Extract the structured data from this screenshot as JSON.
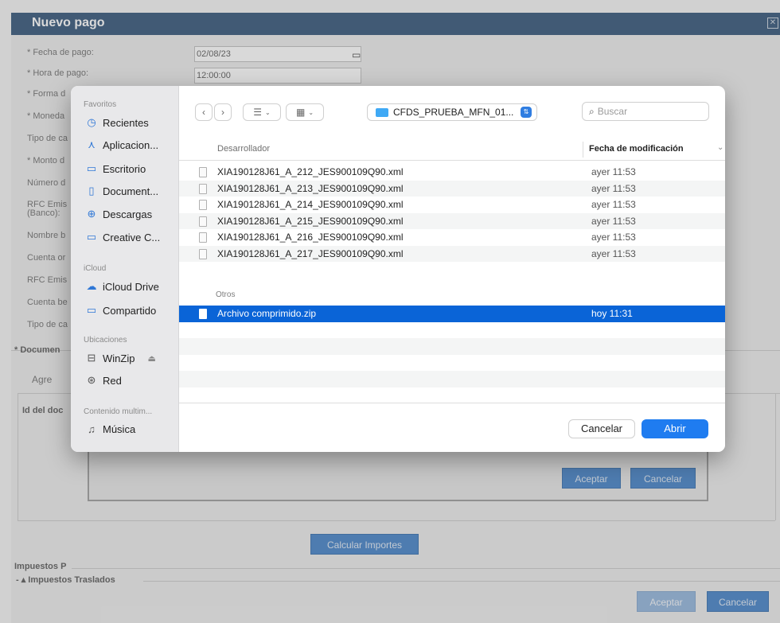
{
  "background_form": {
    "title": "Nuevo pago",
    "close_label": "✕",
    "labels": [
      "* Fecha de pago:",
      "* Hora de pago:",
      "* Forma d",
      "* Moneda",
      "Tipo de ca",
      "* Monto d",
      "Número d",
      "RFC Emis",
      "(Banco):",
      "Nombre b",
      "Cuenta or",
      "RFC Emis",
      "Cuenta be",
      "Tipo de ca"
    ],
    "fecha_value": "02/08/23",
    "hora_value": "12:00:00",
    "documentos_label": "* Documen",
    "agregar_label": "Agre",
    "id_documento_label": "Id del doc",
    "aceptar_label": "Aceptar",
    "cancelar_label": "Cancelar",
    "calcular_label": "Calcular Importes",
    "impuestos_label": "Impuestos P",
    "traslados_label": "Impuestos Traslados",
    "bottom_aceptar_label": "Aceptar",
    "bottom_cancelar_label": "Cancelar"
  },
  "sidebar": {
    "sections": [
      {
        "title": "Favoritos",
        "items": [
          {
            "label": "Recientes",
            "icon": "clock-icon"
          },
          {
            "label": "Aplicacion...",
            "icon": "apps-icon"
          },
          {
            "label": "Escritorio",
            "icon": "desktop-icon"
          },
          {
            "label": "Document...",
            "icon": "document-icon"
          },
          {
            "label": "Descargas",
            "icon": "download-icon"
          },
          {
            "label": "Creative C...",
            "icon": "folder-icon"
          }
        ]
      },
      {
        "title": "iCloud",
        "items": [
          {
            "label": "iCloud Drive",
            "icon": "cloud-icon"
          },
          {
            "label": "Compartido",
            "icon": "shared-folder-icon"
          }
        ]
      },
      {
        "title": "Ubicaciones",
        "items": [
          {
            "label": "WinZip",
            "icon": "drive-icon"
          },
          {
            "label": "Red",
            "icon": "network-icon"
          }
        ]
      },
      {
        "title": "Contenido multim...",
        "items": [
          {
            "label": "Música",
            "icon": "music-icon"
          }
        ]
      }
    ]
  },
  "toolbar": {
    "back_glyph": "‹",
    "forward_glyph": "›",
    "list_view_glyph": "☰",
    "grid_view_glyph": "▦",
    "location": "CFDS_PRUEBA_MFN_01...",
    "search_placeholder": "Buscar"
  },
  "columns": {
    "name": "Desarrollador",
    "date": "Fecha de modificación"
  },
  "files": [
    {
      "name": "XIA190128J61_A_212_JES900109Q90.xml",
      "date": "ayer 11:53"
    },
    {
      "name": "XIA190128J61_A_213_JES900109Q90.xml",
      "date": "ayer 11:53"
    },
    {
      "name": "XIA190128J61_A_214_JES900109Q90.xml",
      "date": "ayer 11:53"
    },
    {
      "name": "XIA190128J61_A_215_JES900109Q90.xml",
      "date": "ayer 11:53"
    },
    {
      "name": "XIA190128J61_A_216_JES900109Q90.xml",
      "date": "ayer 11:53"
    },
    {
      "name": "XIA190128J61_A_217_JES900109Q90.xml",
      "date": "ayer 11:53"
    }
  ],
  "otros_group": {
    "label": "Otros",
    "files": [
      {
        "name": "Archivo comprimido.zip",
        "date": "hoy 11:31",
        "selected": true
      }
    ]
  },
  "footer": {
    "cancel_label": "Cancelar",
    "open_label": "Abrir"
  },
  "colors": {
    "accent": "#1f7cf0",
    "selection": "#0a64d7",
    "bg_header": "#2d4f75"
  }
}
